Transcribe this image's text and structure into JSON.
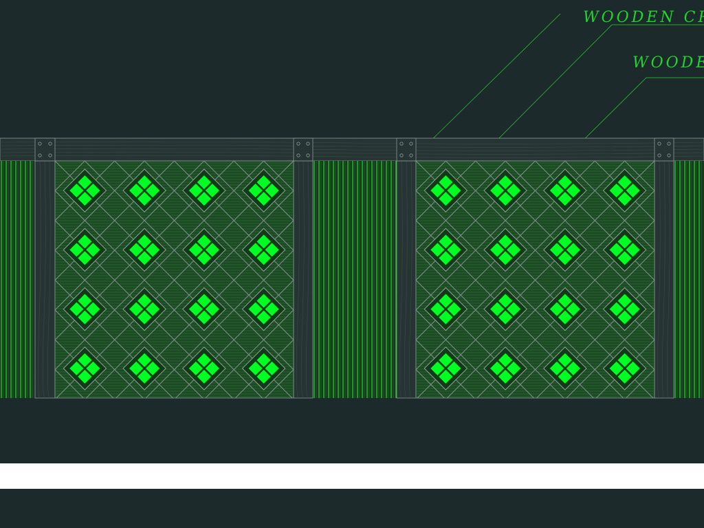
{
  "labels": {
    "crossbar": "WOODEN CROSS",
    "wooden": "WOODEN"
  },
  "colors": {
    "background": "#1c2a2b",
    "line": "#8a9a99",
    "green": "#1fd62c",
    "bright_green": "#00ff22",
    "dark_green": "#0d5a18",
    "post": "#263433",
    "white_strip": "#ffffff"
  },
  "panels": [
    {
      "type": "slat",
      "label": "slat-panel-left-edge"
    },
    {
      "type": "diamond-lattice",
      "label": "lattice-panel-1",
      "rows": 4,
      "cols": 4
    },
    {
      "type": "slat",
      "label": "slat-panel-middle"
    },
    {
      "type": "diamond-lattice",
      "label": "lattice-panel-2",
      "rows": 4,
      "cols": 4
    },
    {
      "type": "slat",
      "label": "slat-panel-right-edge"
    }
  ]
}
